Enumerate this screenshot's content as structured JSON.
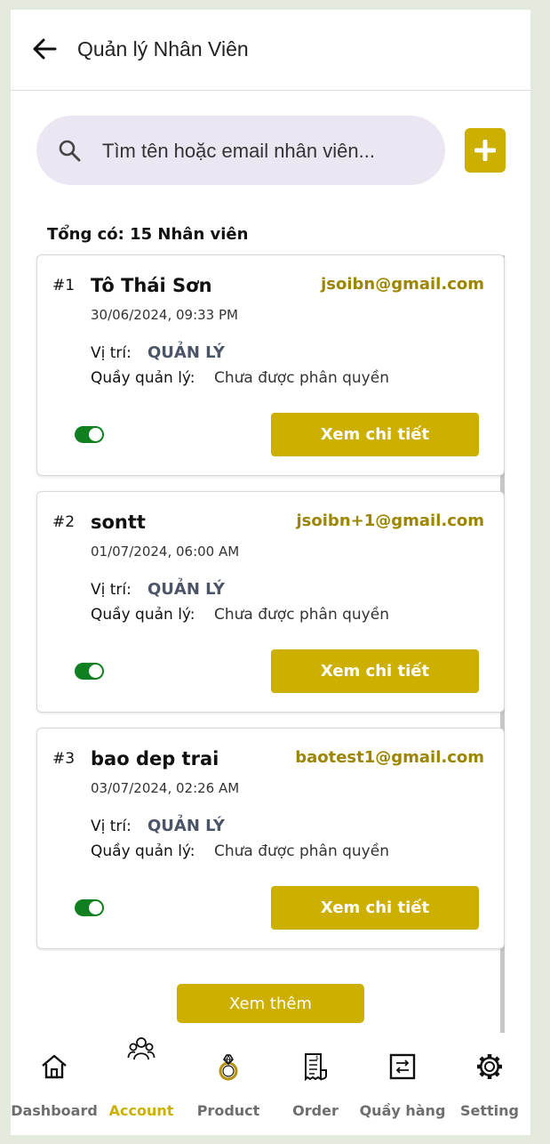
{
  "header": {
    "title": "Quản lý Nhân Viên"
  },
  "search": {
    "placeholder": "Tìm tên hoặc email nhân viên..."
  },
  "summary": {
    "total_text": "Tổng có: 15 Nhân viên"
  },
  "labels": {
    "role": "Vị trí:",
    "counter": "Quầy quản lý:",
    "detail_button": "Xem chi tiết",
    "more_button": "Xem thêm"
  },
  "employees": [
    {
      "index": "#1",
      "name": "Tô Thái Sơn",
      "email": "jsoibn@gmail.com",
      "created": "30/06/2024, 09:33 PM",
      "role": "QUẢN LÝ",
      "counter": "Chưa được phân quyền",
      "active": true
    },
    {
      "index": "#2",
      "name": "sontt",
      "email": "jsoibn+1@gmail.com",
      "created": "01/07/2024, 06:00 AM",
      "role": "QUẢN LÝ",
      "counter": "Chưa được phân quyền",
      "active": true
    },
    {
      "index": "#3",
      "name": "bao dep trai",
      "email": "baotest1@gmail.com",
      "created": "03/07/2024, 02:26 AM",
      "role": "QUẢN LÝ",
      "counter": "Chưa được phân quyền",
      "active": true
    }
  ],
  "nav": {
    "active": "Account",
    "items": [
      {
        "label": "Dashboard",
        "icon": "home-icon"
      },
      {
        "label": "Account",
        "icon": "users-icon"
      },
      {
        "label": "Product",
        "icon": "ring-icon"
      },
      {
        "label": "Order",
        "icon": "receipt-icon"
      },
      {
        "label": "Quầy hàng",
        "icon": "counter-icon"
      },
      {
        "label": "Setting",
        "icon": "gear-icon"
      }
    ]
  },
  "colors": {
    "accent": "#cdaf00",
    "email": "#9c8600",
    "toggle_on": "#0f7f1f",
    "search_bg": "#ece6f3"
  }
}
